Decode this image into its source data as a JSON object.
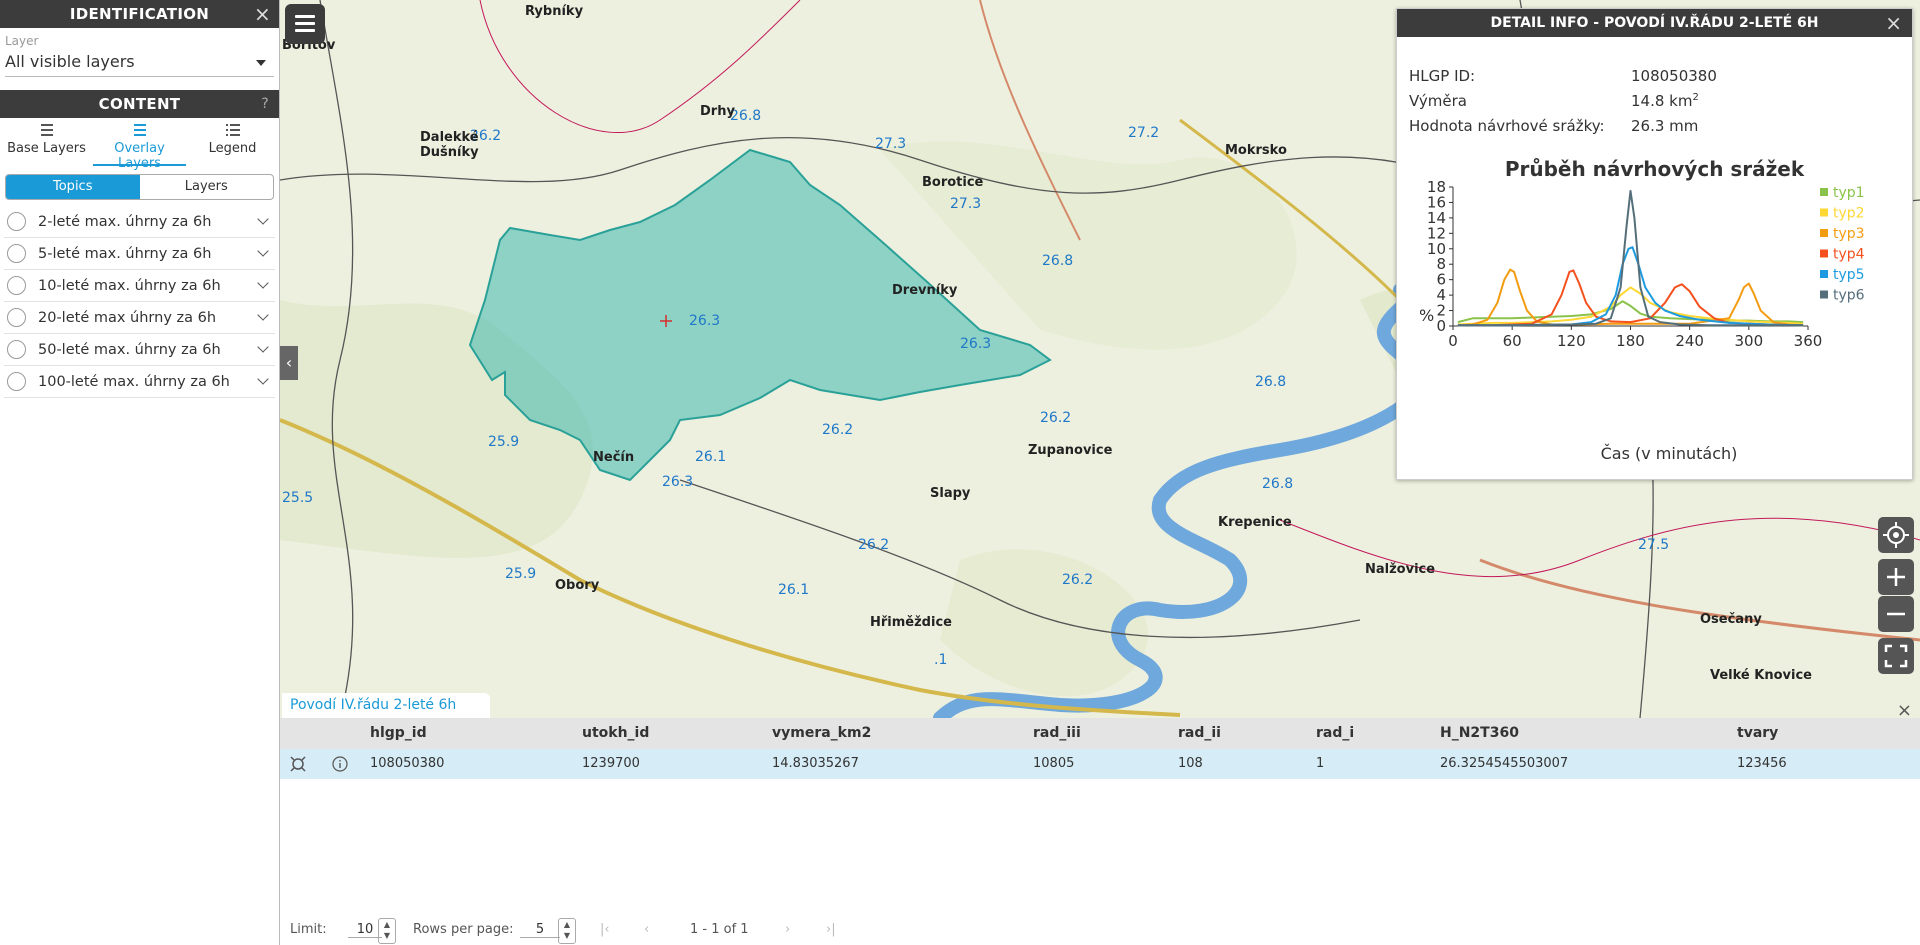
{
  "left_panel": {
    "identification_title": "IDENTIFICATION",
    "layer_label": "Layer",
    "layer_value": "All visible layers",
    "content_title": "CONTENT",
    "help": "?",
    "tabs": [
      {
        "label": "Base Layers",
        "icon": "layers-icon"
      },
      {
        "label": "Overlay Layers",
        "icon": "overlay-list-icon",
        "active": true
      },
      {
        "label": "Legend",
        "icon": "legend-list-icon"
      }
    ],
    "segment": {
      "topics": "Topics",
      "layers": "Layers"
    },
    "topics": [
      "2-leté max. úhrny za 6h",
      "5-leté max. úhrny za 6h",
      "10-leté max. úhrny za 6h",
      "20-leté max úhrny za 6h",
      "50-leté max. úhrny za 6h",
      "100-leté max. úhrny za 6h"
    ]
  },
  "map": {
    "values": [
      "26.8",
      "27.3",
      "26.2",
      "27.2",
      "27.3",
      "26.8",
      "26.3",
      "26.3",
      "26.2",
      "26.2",
      "26.1",
      "26.3",
      "25.9",
      "25.5",
      "25.9",
      "26.2",
      "26.1",
      "26.2",
      "26.8",
      "26.8",
      "27.5",
      ".1"
    ],
    "places": [
      "Rybníky",
      "Bořitov",
      "Dalekké Dušníky",
      "Drhy",
      "Borotice",
      "Drevníky",
      "Nečín",
      "Obory",
      "Hřiměždice",
      "Zupanovice",
      "Nalžovice",
      "Krepenice",
      "Osečany",
      "Mokrsko",
      "Slapy",
      "Velké Knovice"
    ]
  },
  "detail": {
    "title": "DETAIL INFO - POVODÍ IV.ŘÁDU 2-LETÉ 6H",
    "hlgp_label": "HLGP ID:",
    "hlgp_value": "108050380",
    "vymera_label": "Výměra",
    "vymera_value": "14.8 km",
    "vymera_sup": "2",
    "hodnota_label": "Hodnota návrhové srážky:",
    "hodnota_value": "26.3 mm"
  },
  "chart_data": {
    "type": "line",
    "title": "Průběh návrhových srážek",
    "xlabel": "Čas (v minutách)",
    "ylabel": "%",
    "xlim": [
      0,
      360
    ],
    "ylim": [
      0,
      18
    ],
    "xticks": [
      0,
      60,
      120,
      180,
      240,
      300,
      360
    ],
    "yticks": [
      0,
      2,
      4,
      6,
      8,
      10,
      12,
      14,
      16,
      18
    ],
    "legend_position": "right",
    "series": [
      {
        "name": "typ1",
        "color": "#8bc34a",
        "x": [
          5,
          20,
          40,
          60,
          80,
          100,
          120,
          140,
          160,
          172,
          180,
          190,
          200,
          220,
          240,
          260,
          280,
          300,
          320,
          340,
          355
        ],
        "y": [
          0.5,
          1.0,
          1.0,
          1.0,
          1.1,
          1.2,
          1.3,
          1.5,
          2.2,
          3.2,
          2.6,
          1.6,
          1.2,
          1.0,
          0.9,
          0.8,
          0.7,
          0.7,
          0.6,
          0.6,
          0.5
        ]
      },
      {
        "name": "typ2",
        "color": "#fdd835",
        "x": [
          5,
          20,
          40,
          60,
          80,
          100,
          120,
          140,
          160,
          170,
          180,
          190,
          200,
          220,
          240,
          260,
          280,
          300,
          320,
          340,
          355
        ],
        "y": [
          0.2,
          0.3,
          0.4,
          0.4,
          0.5,
          0.6,
          0.8,
          1.2,
          2.5,
          4.0,
          5.0,
          4.2,
          3.0,
          1.8,
          1.3,
          1.0,
          0.8,
          0.6,
          0.5,
          0.4,
          0.3
        ]
      },
      {
        "name": "typ3",
        "color": "#f39c12",
        "x": [
          5,
          20,
          35,
          45,
          52,
          58,
          62,
          68,
          75,
          85,
          100,
          130,
          160,
          200,
          240,
          280,
          290,
          295,
          300,
          305,
          312,
          325,
          340,
          355
        ],
        "y": [
          0.1,
          0.2,
          0.8,
          3.0,
          6.0,
          7.3,
          7.0,
          4.5,
          2.0,
          0.6,
          0.2,
          0.2,
          0.3,
          0.3,
          0.3,
          1.0,
          3.5,
          5.0,
          5.5,
          4.2,
          2.0,
          0.5,
          0.2,
          0.1
        ]
      },
      {
        "name": "typ4",
        "color": "#f4511e",
        "x": [
          5,
          40,
          80,
          100,
          110,
          118,
          122,
          128,
          135,
          145,
          160,
          180,
          200,
          215,
          225,
          232,
          240,
          250,
          265,
          280,
          320,
          355
        ],
        "y": [
          0.1,
          0.1,
          0.3,
          1.5,
          4.0,
          7.0,
          7.2,
          5.5,
          3.0,
          1.2,
          0.6,
          0.5,
          1.0,
          3.0,
          5.0,
          5.4,
          4.5,
          2.5,
          1.0,
          0.4,
          0.2,
          0.1
        ]
      },
      {
        "name": "typ5",
        "color": "#1e9be0",
        "x": [
          5,
          60,
          120,
          140,
          155,
          165,
          172,
          178,
          182,
          188,
          195,
          205,
          215,
          230,
          250,
          280,
          320,
          355
        ],
        "y": [
          0.1,
          0.1,
          0.2,
          0.5,
          1.5,
          4.0,
          8.0,
          10.0,
          10.2,
          8.0,
          5.0,
          3.0,
          2.0,
          1.3,
          0.8,
          0.4,
          0.2,
          0.1
        ]
      },
      {
        "name": "typ6",
        "color": "#546e7a",
        "x": [
          5,
          60,
          120,
          145,
          160,
          170,
          176,
          180,
          184,
          190,
          198,
          210,
          230,
          260,
          300,
          355
        ],
        "y": [
          0.1,
          0.1,
          0.2,
          0.3,
          1.0,
          5.0,
          13.0,
          17.5,
          14.0,
          5.0,
          1.2,
          0.5,
          0.2,
          0.1,
          0.1,
          0.1
        ]
      }
    ]
  },
  "table": {
    "tab_title": "Povodí IV.řádu 2-leté 6h",
    "columns": [
      "hlgp_id",
      "utokh_id",
      "vymera_km2",
      "rad_iii",
      "rad_ii",
      "rad_i",
      "H_N2T360",
      "tvary"
    ],
    "rows": [
      [
        "108050380",
        "1239700",
        "14.83035267",
        "10805",
        "108",
        "1",
        "26.3254545503007",
        "123456"
      ]
    ],
    "pager": {
      "limit_label": "Limit:",
      "limit_value": "10",
      "rows_label": "Rows per page:",
      "rows_value": "5",
      "page_info": "1 - 1 of 1"
    }
  }
}
